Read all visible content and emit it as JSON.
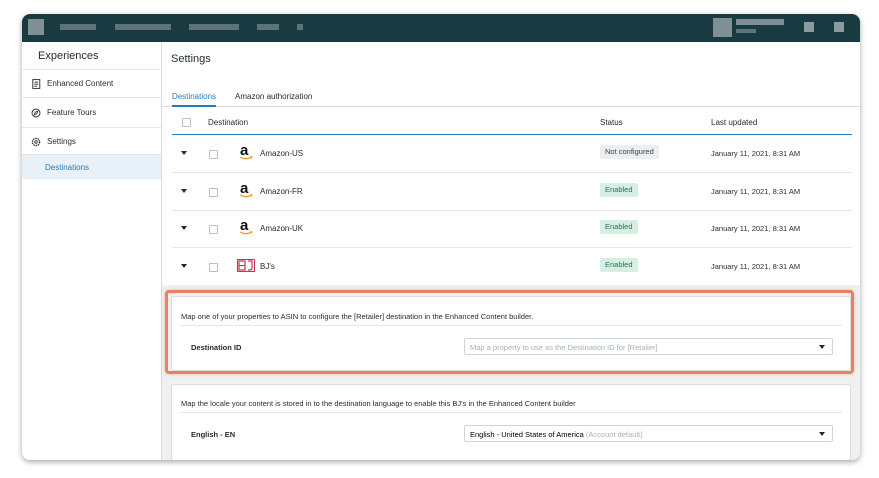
{
  "sidebar": {
    "title": "Experiences",
    "items": [
      {
        "label": "Enhanced Content",
        "icon": "document-icon"
      },
      {
        "label": "Feature Tours",
        "icon": "tour-icon"
      },
      {
        "label": "Settings",
        "icon": "gear-icon"
      }
    ],
    "sub_item": "Destinations"
  },
  "main": {
    "title": "Settings",
    "tabs": [
      {
        "label": "Destinations",
        "active": true
      },
      {
        "label": "Amazon authorization",
        "active": false
      }
    ],
    "table": {
      "headers": {
        "destination": "Destination",
        "status": "Status",
        "updated": "Last updated"
      },
      "rows": [
        {
          "name": "Amazon-US",
          "logo": "amazon",
          "status": "Not configured",
          "status_type": "gray",
          "updated": "January 11, 2021, 8:31 AM"
        },
        {
          "name": "Amazon-FR",
          "logo": "amazon",
          "status": "Enabled",
          "status_type": "green",
          "updated": "January 11, 2021, 8:31 AM"
        },
        {
          "name": "Amazon-UK",
          "logo": "amazon",
          "status": "Enabled",
          "status_type": "green",
          "updated": "January 11, 2021, 8:31 AM"
        },
        {
          "name": "BJ's",
          "logo": "bjs",
          "status": "Enabled",
          "status_type": "green",
          "updated": "January 11, 2021, 8:31 AM"
        }
      ]
    }
  },
  "panel1": {
    "description": "Map one of your properties to ASIN to configure the [Retailer] destination in the Enhanced Content builder.",
    "field_label": "Destination ID",
    "placeholder": "Map a property to use as the Destination ID for [Retailer]"
  },
  "panel2": {
    "description": "Map the locale your content is stored in to the destination language to enable this BJ's in the Enhanced Content builder",
    "field_label": "English - EN",
    "value": "English - United States of America",
    "value_note": "(Account default)"
  },
  "colors": {
    "topbar": "#183a40",
    "accent": "#2a7bb5",
    "highlight": "#e8825a",
    "enabled_bg": "#d6efe3",
    "not_configured_bg": "#eceef0"
  }
}
